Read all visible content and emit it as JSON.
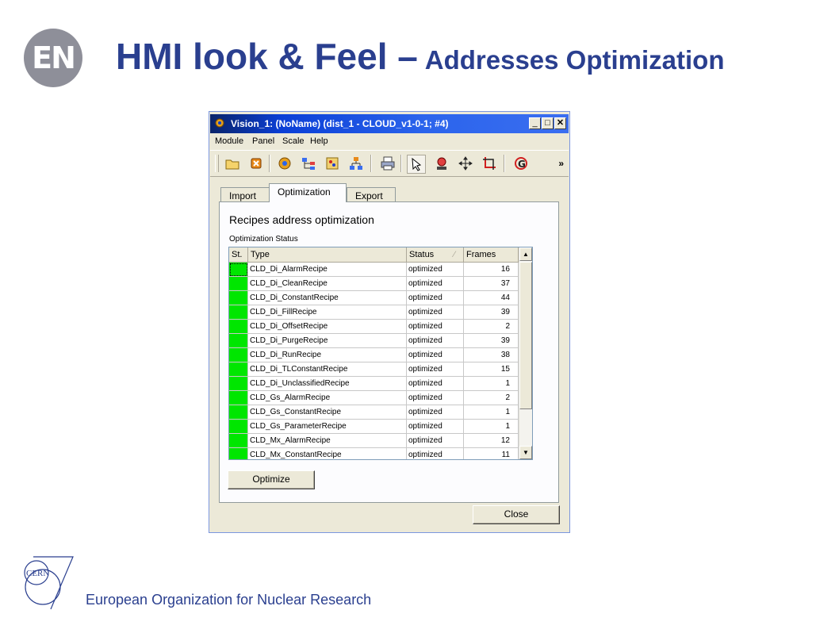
{
  "slide": {
    "logo_text": "EN",
    "title_main": "HMI look & Feel –",
    "title_sub": "Addresses Optimization",
    "footer_logo_text": "CERN",
    "footer_text": "European Organization for Nuclear Research"
  },
  "window": {
    "title": "Vision_1: (NoName) (dist_1 - CLOUD_v1-0-1; #4)",
    "controls": {
      "minimize": "_",
      "maximize": "□",
      "close": "✕"
    }
  },
  "menu": [
    "Module",
    "Panel",
    "Scale",
    "Help"
  ],
  "toolbar": {
    "icons": [
      "open-folder-icon",
      "close-module-icon",
      "gear-icon",
      "tree-view-icon",
      "palette-icon",
      "hierarchy-icon",
      "print-icon",
      "select-pointer-icon",
      "zoom-tool-icon",
      "move-tool-icon",
      "crop-tool-icon",
      "refresh-g-icon"
    ],
    "overflow": "»"
  },
  "tabs": [
    {
      "label": "Import",
      "active": false
    },
    {
      "label": "Optimization",
      "active": true
    },
    {
      "label": "Export",
      "active": false
    }
  ],
  "panel": {
    "heading": "Recipes address optimization",
    "status_label": "Optimization Status"
  },
  "table": {
    "columns": [
      "St.",
      "Type",
      "Status",
      "Frames"
    ],
    "status_color": "#00e600",
    "rows": [
      {
        "type": "CLD_Di_AlarmRecipe",
        "status": "optimized",
        "frames": "16"
      },
      {
        "type": "CLD_Di_CleanRecipe",
        "status": "optimized",
        "frames": "37"
      },
      {
        "type": "CLD_Di_ConstantRecipe",
        "status": "optimized",
        "frames": "44"
      },
      {
        "type": "CLD_Di_FillRecipe",
        "status": "optimized",
        "frames": "39"
      },
      {
        "type": "CLD_Di_OffsetRecipe",
        "status": "optimized",
        "frames": "2"
      },
      {
        "type": "CLD_Di_PurgeRecipe",
        "status": "optimized",
        "frames": "39"
      },
      {
        "type": "CLD_Di_RunRecipe",
        "status": "optimized",
        "frames": "38"
      },
      {
        "type": "CLD_Di_TLConstantRecipe",
        "status": "optimized",
        "frames": "15"
      },
      {
        "type": "CLD_Di_UnclassifiedRecipe",
        "status": "optimized",
        "frames": "1"
      },
      {
        "type": "CLD_Gs_AlarmRecipe",
        "status": "optimized",
        "frames": "2"
      },
      {
        "type": "CLD_Gs_ConstantRecipe",
        "status": "optimized",
        "frames": "1"
      },
      {
        "type": "CLD_Gs_ParameterRecipe",
        "status": "optimized",
        "frames": "1"
      },
      {
        "type": "CLD_Mx_AlarmRecipe",
        "status": "optimized",
        "frames": "12"
      },
      {
        "type": "CLD_Mx_ConstantRecipe",
        "status": "optimized",
        "frames": "11"
      }
    ]
  },
  "buttons": {
    "optimize": "Optimize",
    "close": "Close"
  },
  "colors": {
    "title_blue": "#2a3f8f",
    "titlebar_blue": "#0b3fd6",
    "window_bg": "#ece9d8"
  }
}
